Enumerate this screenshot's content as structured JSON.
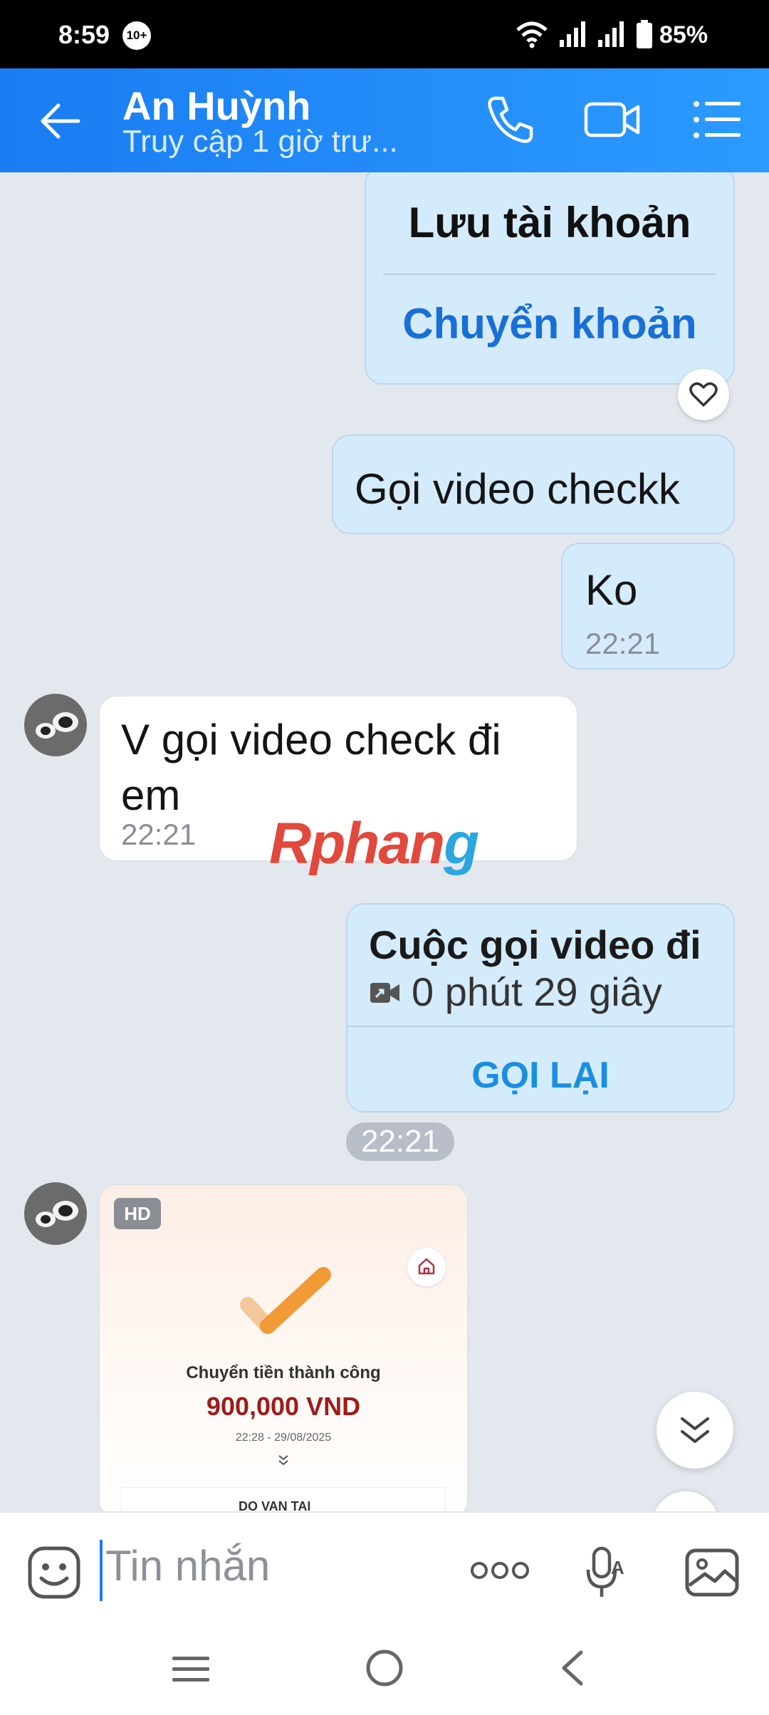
{
  "status_bar": {
    "time": "8:59",
    "notification_badge": "10+",
    "battery": "85%"
  },
  "header": {
    "contact_name": "An Huỳnh",
    "last_seen": "Truy cập 1 giờ trư..."
  },
  "messages": {
    "card_save_account": "Lưu tài khoản",
    "card_transfer": "Chuyển khoản",
    "m1_text": "Gọi video checkk",
    "m2_text": "Ko",
    "m2_time": "22:21",
    "m3_text": "V gọi video check đi em",
    "m3_time": "22:21",
    "watermark_main": "Rphan",
    "watermark_tail": "g",
    "call_title": "Cuộc gọi video đi",
    "call_duration": "0 phút 29 giây",
    "call_again": "GỌI LẠI",
    "time_pill": "22:21"
  },
  "image_card": {
    "quality_badge": "HD",
    "status_text": "Chuyển tiền thành công",
    "amount": "900,000 VND",
    "datetime": "22:28 - 29/08/2025",
    "recipient_partial": "DO VAN TAI"
  },
  "composer": {
    "placeholder": "Tin nhắn"
  },
  "colors": {
    "header_blue": "#1a7cf2",
    "outgoing_bubble": "#d4ebfc",
    "link_blue": "#1a6fd6",
    "amount_red": "#9d1c1c"
  },
  "icons": [
    "back-arrow-icon",
    "phone-icon",
    "video-camera-icon",
    "list-menu-icon",
    "heart-icon",
    "video-call-icon",
    "home-icon",
    "chevron-down-icon",
    "emoji-icon",
    "more-dots-icon",
    "voice-mic-icon",
    "gallery-icon"
  ]
}
